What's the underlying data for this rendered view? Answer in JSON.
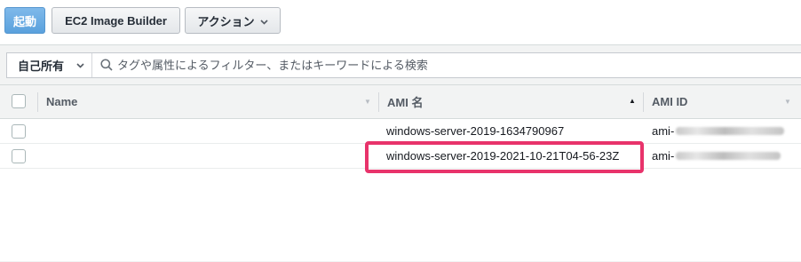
{
  "toolbar": {
    "launch_label": "起動",
    "image_builder_label": "EC2 Image Builder",
    "actions_label": "アクション"
  },
  "filter": {
    "owner_label": "自己所有",
    "search_placeholder": "タグや属性によるフィルター、またはキーワードによる検索"
  },
  "table": {
    "columns": {
      "name": "Name",
      "ami_name": "AMI 名",
      "ami_id": "AMI ID"
    },
    "sorted_column": "AMI 名",
    "rows": [
      {
        "name": "",
        "ami_name": "windows-server-2019-1634790967",
        "ami_id_prefix": "ami-",
        "ami_id_redacted": true
      },
      {
        "name": "",
        "ami_name": "windows-server-2019-2021-10-21T04-56-23Z",
        "ami_id_prefix": "ami-",
        "ami_id_redacted": true,
        "highlighted": true
      }
    ]
  },
  "colors": {
    "primary_button": "#5aa1dd",
    "highlight_border": "#e8336b",
    "panel_background": "#f2f3f3"
  }
}
